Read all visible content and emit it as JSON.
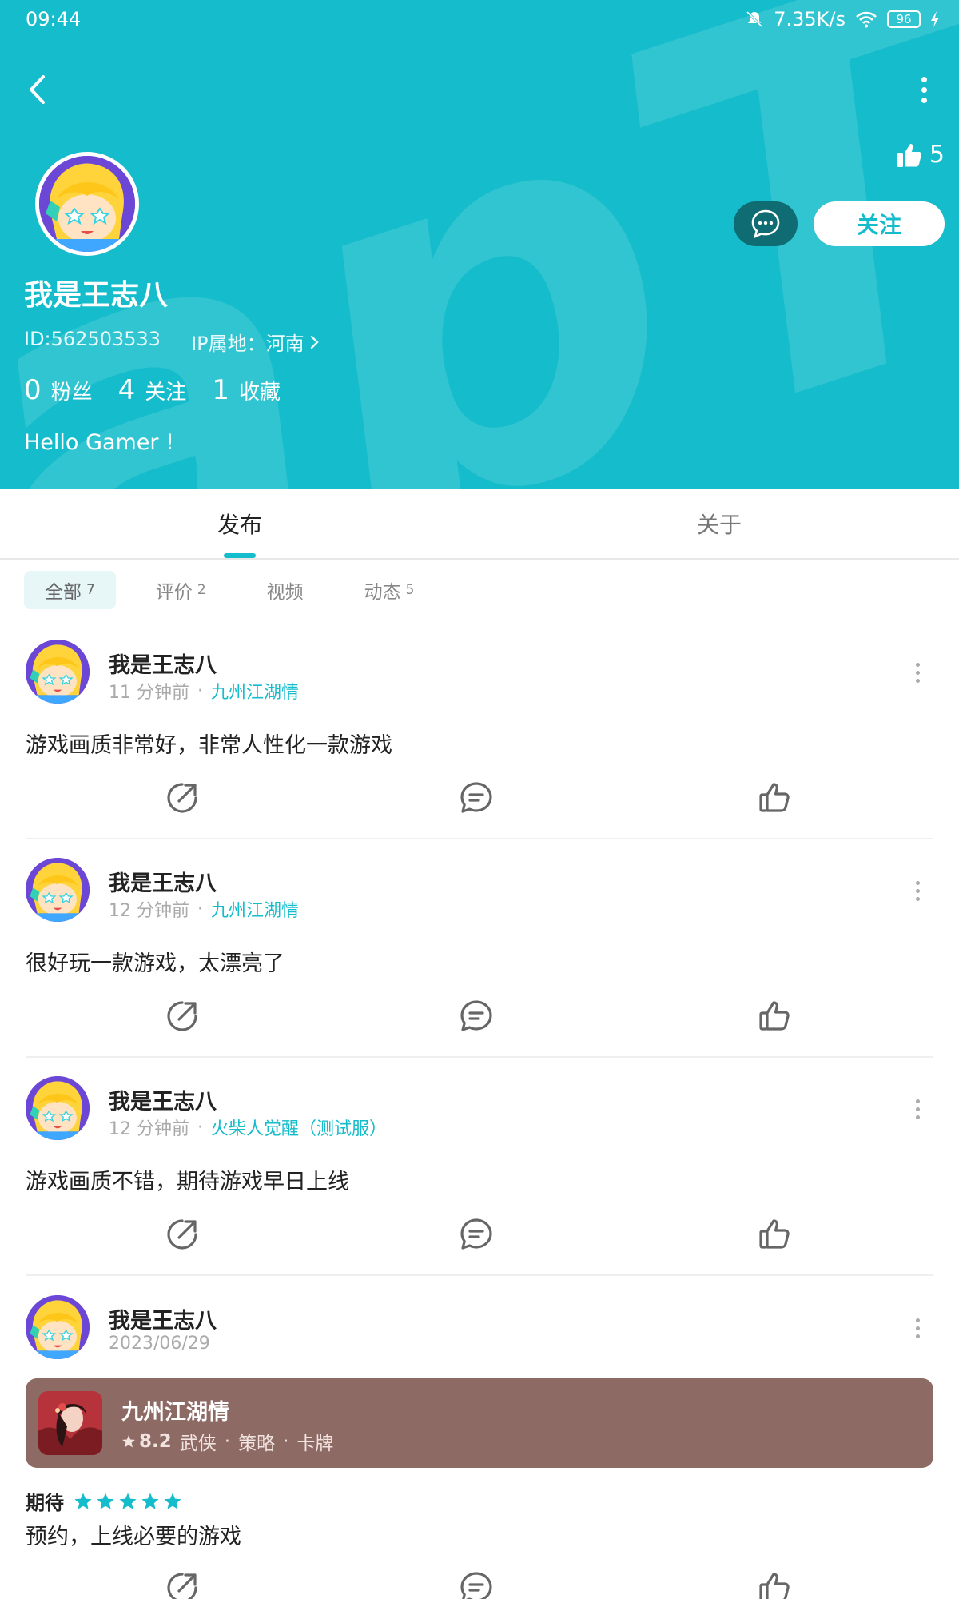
{
  "status_bar": {
    "time": "09:44",
    "net_speed": "7.35K/s",
    "battery": "96"
  },
  "profile": {
    "likes": "5",
    "name": "我是王志八",
    "id_text": "ID:562503533",
    "ip_text": "IP属地：河南",
    "follow_label": "关注",
    "stats": [
      {
        "num": "0",
        "label": "粉丝"
      },
      {
        "num": "4",
        "label": "关注"
      },
      {
        "num": "1",
        "label": "收藏"
      }
    ],
    "bio": "Hello Gamer !"
  },
  "tabs": [
    {
      "label": "发布"
    },
    {
      "label": "关于"
    }
  ],
  "filters": [
    {
      "label": "全部",
      "count": "7"
    },
    {
      "label": "评价",
      "count": "2"
    },
    {
      "label": "视频",
      "count": ""
    },
    {
      "label": "动态",
      "count": "5"
    }
  ],
  "posts": [
    {
      "name": "我是王志八",
      "time": "11 分钟前",
      "sep": "·",
      "game": "九州江湖情",
      "text": "游戏画质非常好，非常人性化一款游戏"
    },
    {
      "name": "我是王志八",
      "time": "12 分钟前",
      "sep": "·",
      "game": "九州江湖情",
      "text": "很好玩一款游戏，太漂亮了"
    },
    {
      "name": "我是王志八",
      "time": "12 分钟前",
      "sep": "·",
      "game": "火柴人觉醒（测试服）",
      "text": "游戏画质不错，期待游戏早日上线"
    },
    {
      "name": "我是王志八",
      "time": "2023/06/29",
      "card": {
        "title": "九州江湖情",
        "score": "8.2",
        "tags": [
          "武侠",
          "策略",
          "卡牌"
        ],
        "sep": "·"
      },
      "rating_label": "期待",
      "stars": 5,
      "text": "预约，上线必要的游戏"
    }
  ],
  "colors": {
    "primary": "#15bccb",
    "msg_button": "#0e6c72",
    "card_bg": "#8e6a64"
  }
}
